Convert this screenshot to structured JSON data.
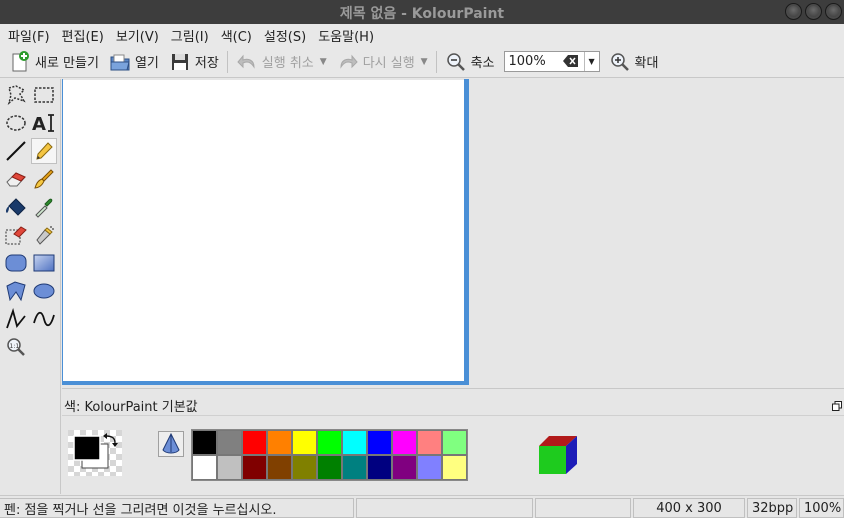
{
  "window": {
    "title": "제목 없음 - KolourPaint"
  },
  "menu": [
    "파일(F)",
    "편집(E)",
    "보기(V)",
    "그림(I)",
    "색(C)",
    "설정(S)",
    "도움말(H)"
  ],
  "toolbar": {
    "new_label": "새로 만들기",
    "open_label": "열기",
    "save_label": "저장",
    "undo_label": "실행 취소",
    "redo_label": "다시 실행",
    "zoom_out_label": "축소",
    "zoom_value": "100%",
    "zoom_in_label": "확대"
  },
  "tools": [
    {
      "name": "free-form-selection",
      "icon": "lasso-icon"
    },
    {
      "name": "rectangular-selection",
      "icon": "rect-select-icon"
    },
    {
      "name": "elliptical-selection",
      "icon": "ellipse-select-icon"
    },
    {
      "name": "text",
      "icon": "text-icon"
    },
    {
      "name": "line",
      "icon": "line-icon"
    },
    {
      "name": "pen",
      "icon": "pencil-icon",
      "active": true
    },
    {
      "name": "eraser",
      "icon": "eraser-icon"
    },
    {
      "name": "brush",
      "icon": "brush-icon"
    },
    {
      "name": "flood-fill",
      "icon": "fill-bucket-icon"
    },
    {
      "name": "color-picker",
      "icon": "eyedropper-icon"
    },
    {
      "name": "color-eraser",
      "icon": "color-eraser-icon"
    },
    {
      "name": "spraycan",
      "icon": "spraycan-icon"
    },
    {
      "name": "rounded-rectangle",
      "icon": "rounded-rect-icon"
    },
    {
      "name": "rectangle",
      "icon": "rectangle-icon"
    },
    {
      "name": "polygon",
      "icon": "polygon-icon"
    },
    {
      "name": "ellipse",
      "icon": "ellipse-icon"
    },
    {
      "name": "connected-lines",
      "icon": "polyline-icon"
    },
    {
      "name": "curve",
      "icon": "curve-icon"
    },
    {
      "name": "zoom",
      "icon": "zoom-tool-icon"
    }
  ],
  "color_panel": {
    "title": "색: KolourPaint 기본값",
    "foreground": "#000000",
    "background": "#ffffff",
    "palette_top": [
      "#000000",
      "#808080",
      "#ff0000",
      "#ff8000",
      "#ffff00",
      "#00ff00",
      "#00ffff",
      "#0000ff",
      "#ff00ff",
      "#ff8080",
      "#80ff80"
    ],
    "palette_bottom": [
      "#ffffff",
      "#c0c0c0",
      "#800000",
      "#804000",
      "#808000",
      "#008000",
      "#008080",
      "#000080",
      "#800080",
      "#8080ff",
      "#ffff80"
    ]
  },
  "status": {
    "message": "펜: 점을 찍거나 선을 그리려면 이것을 누르십시오.",
    "image_size": "400 x 300",
    "bpp": "32bpp",
    "zoom": "100%"
  }
}
